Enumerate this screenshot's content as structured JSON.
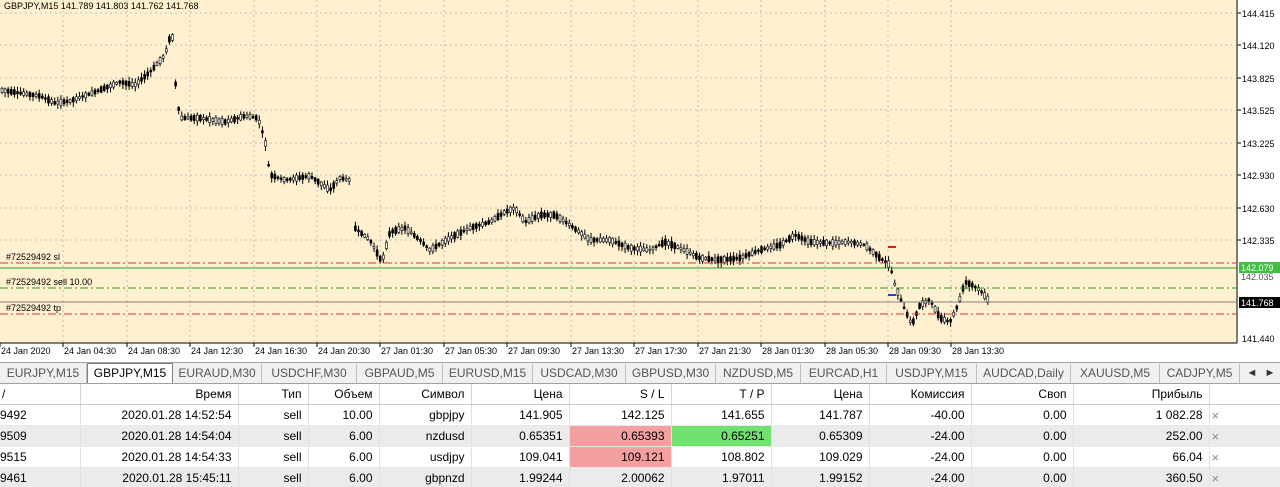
{
  "chart": {
    "header": "GBPJPY,M15  141.789 141.803 141.762 141.768",
    "background": "#fff0d0",
    "candle_color": "#000000",
    "price_levels": [
      "144.415",
      "144.120",
      "143.825",
      "143.525",
      "143.225",
      "142.930",
      "142.630",
      "142.335"
    ],
    "lower_price_levels": [
      "141.440"
    ],
    "price_tags": {
      "sl": "142.079",
      "current": "141.768"
    },
    "time_labels": [
      "24 Jan 2020",
      "24 Jan 04:30",
      "24 Jan 08:30",
      "24 Jan 12:30",
      "24 Jan 16:30",
      "24 Jan 20:30",
      "27 Jan 01:30",
      "27 Jan 05:30",
      "27 Jan 09:30",
      "27 Jan 13:30",
      "27 Jan 17:30",
      "27 Jan 21:30",
      "28 Jan 01:30",
      "28 Jan 05:30",
      "28 Jan 09:30",
      "28 Jan 13:30"
    ],
    "order_labels": {
      "sl": "#72529492 sl",
      "sell": "#72529492 sell 10.00",
      "tp": "#72529492 tp"
    },
    "colors": {
      "grid": "#c0c0c0",
      "sl_line": "#e03030",
      "open_line": "#20a020",
      "bid_line": "#808080",
      "sl_tag_bg": "#40c040",
      "price_tag_bg": "#000000"
    },
    "price_axis_partial": "142.035"
  },
  "tabs": [
    {
      "label": "EURJPY,M15",
      "active": false
    },
    {
      "label": "GBPJPY,M15",
      "active": true
    },
    {
      "label": "EURAUD,M30",
      "active": false
    },
    {
      "label": "USDCHF,M30",
      "active": false
    },
    {
      "label": "GBPAUD,M5",
      "active": false
    },
    {
      "label": "EURUSD,M15",
      "active": false
    },
    {
      "label": "USDCAD,M30",
      "active": false
    },
    {
      "label": "GBPUSD,M30",
      "active": false
    },
    {
      "label": "NZDUSD,M5",
      "active": false
    },
    {
      "label": "EURCAD,H1",
      "active": false
    },
    {
      "label": "USDJPY,M15",
      "active": false
    },
    {
      "label": "AUDCAD,Daily",
      "active": false
    },
    {
      "label": "XAUUSD,M5",
      "active": false
    },
    {
      "label": "CADJPY,M5",
      "active": false
    }
  ],
  "tab_arrows": {
    "left": "◄",
    "right": "►"
  },
  "table": {
    "headers": [
      "/",
      "Время",
      "Тип",
      "Объем",
      "Символ",
      "Цена",
      "S / L",
      "T / P",
      "Цена",
      "Комиссия",
      "Своп",
      "Прибыль"
    ],
    "rows": [
      {
        "ticket": "9492",
        "time": "2020.01.28 14:52:54",
        "type": "sell",
        "volume": "10.00",
        "symbol": "gbpjpy",
        "price": "141.905",
        "sl": "142.125",
        "tp": "141.655",
        "cur": "141.787",
        "commission": "-40.00",
        "swap": "0.00",
        "profit": "1 082.28",
        "close": "×"
      },
      {
        "ticket": "9509",
        "time": "2020.01.28 14:54:04",
        "type": "sell",
        "volume": "6.00",
        "symbol": "nzdusd",
        "price": "0.65351",
        "sl": "0.65393",
        "tp": "0.65251",
        "cur": "0.65309",
        "commission": "-24.00",
        "swap": "0.00",
        "profit": "252.00",
        "close": "×",
        "sl_color": "#f4a0a0",
        "tp_color": "#70e070"
      },
      {
        "ticket": "9515",
        "time": "2020.01.28 14:54:33",
        "type": "sell",
        "volume": "6.00",
        "symbol": "usdjpy",
        "price": "109.041",
        "sl": "109.121",
        "tp": "108.802",
        "cur": "109.029",
        "commission": "-24.00",
        "swap": "0.00",
        "profit": "66.04",
        "close": "×",
        "sl_color": "#f4a0a0"
      },
      {
        "ticket": "9461",
        "time": "2020.01.28 15:45:11",
        "type": "sell",
        "volume": "6.00",
        "symbol": "gbpnzd",
        "price": "1.99244",
        "sl": "2.00062",
        "tp": "1.97011",
        "cur": "1.99152",
        "commission": "-24.00",
        "swap": "0.00",
        "profit": "360.50",
        "close": "×"
      }
    ]
  }
}
